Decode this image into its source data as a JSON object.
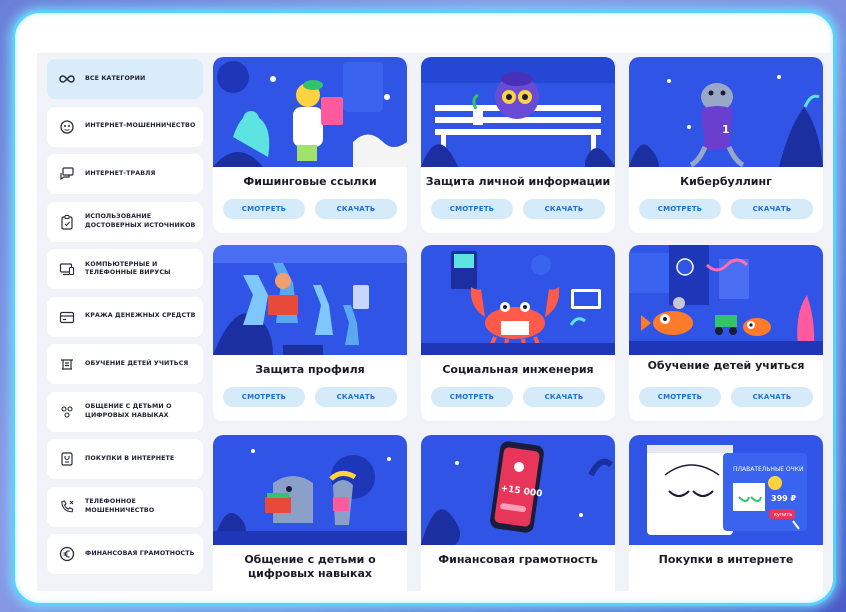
{
  "sidebar": {
    "items": [
      {
        "label": "ВСЕ КАТЕГОРИИ",
        "icon": "infinity-icon",
        "active": true
      },
      {
        "label": "ИНТЕРНЕТ-МОШЕННИЧЕСТВО",
        "icon": "mask-icon"
      },
      {
        "label": "ИНТЕРНЕТ-ТРАВЛЯ",
        "icon": "chat-icon"
      },
      {
        "label": "ИСПОЛЬЗОВАНИЕ ДОСТОВЕРНЫХ ИСТОЧНИКОВ",
        "icon": "clipboard-icon"
      },
      {
        "label": "КОМПЬЮТЕРНЫЕ И ТЕЛЕФОННЫЕ ВИРУСЫ",
        "icon": "devices-icon"
      },
      {
        "label": "КРАЖА ДЕНЕЖНЫХ СРЕДСТВ",
        "icon": "wallet-icon"
      },
      {
        "label": "ОБУЧЕНИЕ ДЕТЕЙ УЧИТЬСЯ",
        "icon": "school-icon"
      },
      {
        "label": "ОБЩЕНИЕ С ДЕТЬМИ О ЦИФРОВЫХ НАВЫКАХ",
        "icon": "people-icon"
      },
      {
        "label": "ПОКУПКИ В ИНТЕРНЕТЕ",
        "icon": "shopping-icon"
      },
      {
        "label": "ТЕЛЕФОННОЕ МОШЕННИЧЕСТВО",
        "icon": "phone-icon"
      },
      {
        "label": "ФИНАНСОВАЯ ГРАМОТНОСТЬ",
        "icon": "euro-icon"
      }
    ]
  },
  "cards": [
    {
      "title": "Фишинговые ссылки",
      "view": "СМОТРЕТЬ",
      "download": "СКАЧАТЬ"
    },
    {
      "title": "Защита личной информации",
      "view": "СМОТРЕТЬ",
      "download": "СКАЧАТЬ"
    },
    {
      "title": "Кибербуллинг",
      "view": "СМОТРЕТЬ",
      "download": "СКАЧАТЬ"
    },
    {
      "title": "Защита профиля",
      "view": "СМОТРЕТЬ",
      "download": "СКАЧАТЬ"
    },
    {
      "title": "Социальная инженерия",
      "view": "СМОТРЕТЬ",
      "download": "СКАЧАТЬ"
    },
    {
      "title": "Обучение детей учиться",
      "view": "СМОТРЕТЬ",
      "download": "СКАЧАТЬ"
    },
    {
      "title": "Общение с детьми о цифровых навыках"
    },
    {
      "title": "Финансовая грамотность"
    },
    {
      "title": "Покупки в интернете"
    }
  ],
  "illustrations": {
    "card8_amount": "+15 000",
    "card9_banner": "ПЛАВАТЕЛЬНЫЕ ОЧКИ",
    "card9_price": "399 ₽",
    "card9_buy": "купить"
  },
  "colors": {
    "art_blue": "#2f54e6",
    "art_dark": "#1e36b8",
    "button_bg": "#d6ebfa",
    "button_text": "#1d6fd6",
    "frame_glow": "#5ad0ff"
  }
}
